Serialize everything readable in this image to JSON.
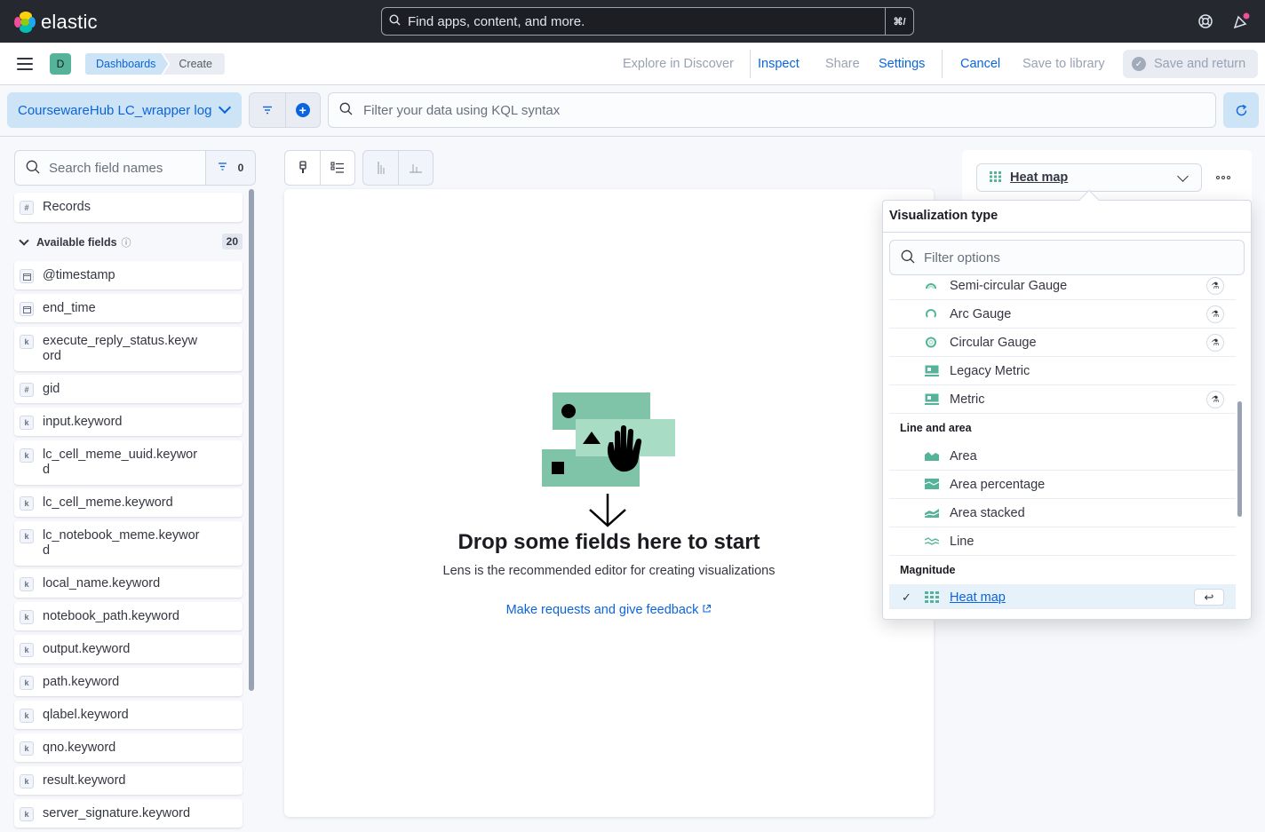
{
  "header": {
    "brand": "elastic",
    "search_placeholder": "Find apps, content, and more.",
    "search_shortcut": "⌘/",
    "help_icon": "help-icon",
    "news_icon": "news-icon"
  },
  "nav": {
    "space_initial": "D",
    "breadcrumbs": [
      "Dashboards",
      "Create"
    ],
    "explore_discover": "Explore in Discover",
    "inspect": "Inspect",
    "share": "Share",
    "settings": "Settings",
    "cancel": "Cancel",
    "save_library": "Save to library",
    "save_return": "Save and return"
  },
  "query": {
    "data_view": "CoursewareHub LC_wrapper log",
    "kql_placeholder": "Filter your data using KQL syntax"
  },
  "fields": {
    "search_placeholder": "Search field names",
    "filter_count": "0",
    "records": "Records",
    "available_label": "Available fields",
    "available_count": "20",
    "items": [
      {
        "type": "date",
        "name": "@timestamp"
      },
      {
        "type": "date",
        "name": "end_time"
      },
      {
        "type": "k",
        "name": "execute_reply_status.keyword"
      },
      {
        "type": "#",
        "name": "gid"
      },
      {
        "type": "k",
        "name": "input.keyword"
      },
      {
        "type": "k",
        "name": "lc_cell_meme_uuid.keyword"
      },
      {
        "type": "k",
        "name": "lc_cell_meme.keyword"
      },
      {
        "type": "k",
        "name": "lc_notebook_meme.keyword"
      },
      {
        "type": "k",
        "name": "local_name.keyword"
      },
      {
        "type": "k",
        "name": "notebook_path.keyword"
      },
      {
        "type": "k",
        "name": "output.keyword"
      },
      {
        "type": "k",
        "name": "path.keyword"
      },
      {
        "type": "k",
        "name": "qlabel.keyword"
      },
      {
        "type": "k",
        "name": "qno.keyword"
      },
      {
        "type": "k",
        "name": "result.keyword"
      },
      {
        "type": "k",
        "name": "server_signature.keyword"
      }
    ]
  },
  "workspace": {
    "drop_title": "Drop some fields here to start",
    "drop_subtitle": "Lens is the recommended editor for creating visualizations",
    "feedback_link": "Make requests and give feedback"
  },
  "config": {
    "vis_selected": "Heat map",
    "popover_title": "Visualization type",
    "filter_placeholder": "Filter options",
    "options_top": [
      {
        "label": "Semi-circular Gauge",
        "icon": "gauge-icon",
        "beta": true
      },
      {
        "label": "Arc Gauge",
        "icon": "gauge-icon",
        "beta": true
      },
      {
        "label": "Circular Gauge",
        "icon": "gauge-icon",
        "beta": true
      },
      {
        "label": "Legacy Metric",
        "icon": "metric-icon",
        "beta": false
      },
      {
        "label": "Metric",
        "icon": "metric-icon",
        "beta": true
      }
    ],
    "group_line_area": "Line and area",
    "options_line": [
      {
        "label": "Area",
        "icon": "area-icon"
      },
      {
        "label": "Area percentage",
        "icon": "area-percentage-icon"
      },
      {
        "label": "Area stacked",
        "icon": "area-stacked-icon"
      },
      {
        "label": "Line",
        "icon": "line-icon"
      }
    ],
    "group_magnitude": "Magnitude",
    "selected_option": "Heat map",
    "beta_glyph": "⚗",
    "enter_glyph": "↩"
  },
  "colors": {
    "header_bg": "#25282f",
    "accent": "#0b64dd",
    "vis_green": "#54b399"
  }
}
